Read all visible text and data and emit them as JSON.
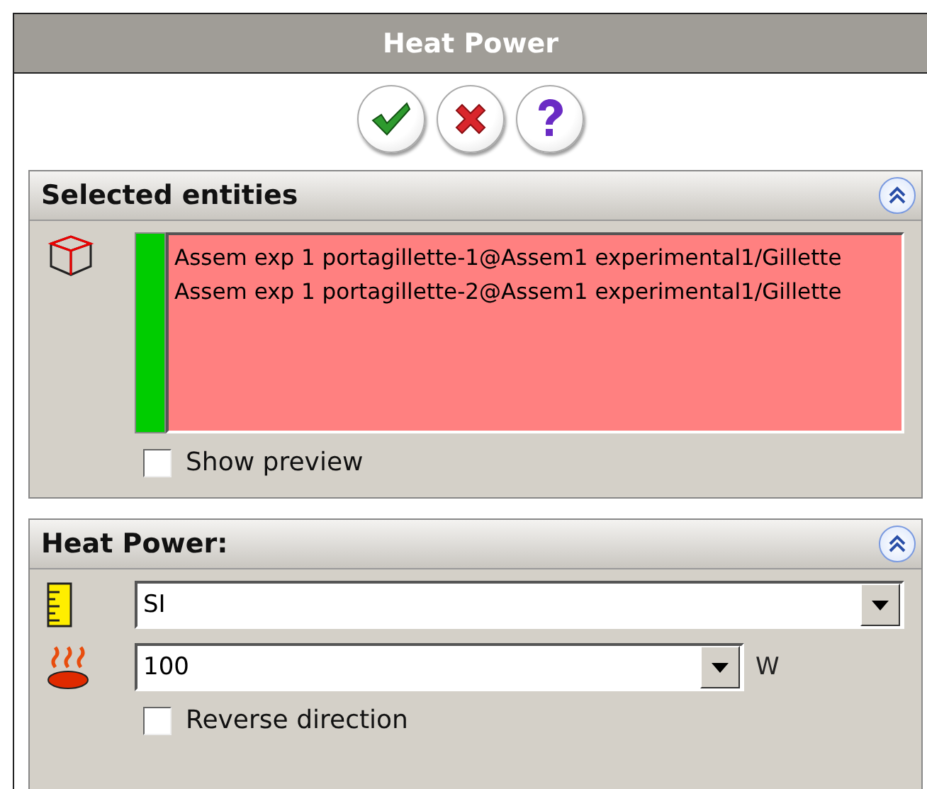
{
  "window": {
    "title": "Heat Power"
  },
  "actions": [
    {
      "kind": "ok"
    },
    {
      "kind": "cancel"
    },
    {
      "kind": "help"
    }
  ],
  "selected_entities": {
    "title": "Selected entities",
    "expanded": true,
    "items": [
      "Assem exp 1 portagillette-1@Assem1 experimental1/Gillette",
      "Assem exp 1 portagillette-2@Assem1 experimental1/Gillette"
    ],
    "show_preview": {
      "label": "Show preview",
      "checked": false
    }
  },
  "heat_power": {
    "title": "Heat Power:",
    "expanded": true,
    "unit_system": {
      "value": "SI"
    },
    "power": {
      "value": "100",
      "unit": "W"
    },
    "reverse_direction": {
      "label": "Reverse direction",
      "checked": false
    }
  }
}
